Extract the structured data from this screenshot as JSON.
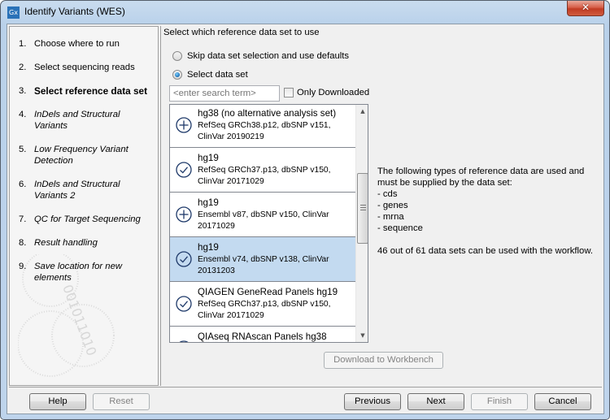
{
  "window": {
    "title": "Identify Variants (WES)",
    "app_icon_text": "Gx",
    "close_symbol": "✕"
  },
  "steps": [
    {
      "num": "1.",
      "label": "Choose where to run",
      "state": "done"
    },
    {
      "num": "2.",
      "label": "Select sequencing reads",
      "state": "done"
    },
    {
      "num": "3.",
      "label": "Select reference data set",
      "state": "current"
    },
    {
      "num": "4.",
      "label": "InDels and Structural Variants",
      "state": "future"
    },
    {
      "num": "5.",
      "label": "Low Frequency Variant Detection",
      "state": "future"
    },
    {
      "num": "6.",
      "label": "InDels and Structural Variants 2",
      "state": "future"
    },
    {
      "num": "7.",
      "label": "QC for Target Sequencing",
      "state": "future"
    },
    {
      "num": "8.",
      "label": "Result handling",
      "state": "future"
    },
    {
      "num": "9.",
      "label": "Save location for new elements",
      "state": "future"
    }
  ],
  "content": {
    "section_title": "Select which reference data set to use",
    "radio_skip": {
      "label": "Skip data set selection and use defaults",
      "checked": false
    },
    "radio_select": {
      "label": "Select data set",
      "checked": true
    },
    "search": {
      "placeholder": "<enter search term>",
      "value": ""
    },
    "only_downloaded": {
      "label": "Only Downloaded",
      "checked": false
    },
    "datasets": [
      {
        "title": "hg38 (no alternative analysis set)",
        "desc": "RefSeq GRCh38.p12, dbSNP v151, ClinVar 20190219",
        "status": "download",
        "icon": "plus-circle-icon",
        "selected": false
      },
      {
        "title": "hg19",
        "desc": "RefSeq GRCh37.p13, dbSNP v150, ClinVar 20171029",
        "status": "downloaded",
        "icon": "check-circle-icon",
        "selected": false
      },
      {
        "title": "hg19",
        "desc": "Ensembl v87, dbSNP v150, ClinVar 20171029",
        "status": "download",
        "icon": "plus-circle-icon",
        "selected": false
      },
      {
        "title": "hg19",
        "desc": "Ensembl v74, dbSNP v138, ClinVar 20131203",
        "status": "downloaded",
        "icon": "check-circle-icon",
        "selected": true
      },
      {
        "title": "QIAGEN GeneRead Panels hg19",
        "desc": "RefSeq GRCh37.p13, dbSNP v150, ClinVar 20171029",
        "status": "downloaded",
        "icon": "check-circle-icon",
        "selected": false
      },
      {
        "title": "QIAseq RNAscan Panels hg38",
        "desc": "",
        "status": "download",
        "icon": "plus-circle-icon",
        "selected": false
      }
    ],
    "scroll_position_fraction": 0.35,
    "info": {
      "intro": "The following types of reference data are used and must be supplied by the data set:",
      "types": [
        "- cds",
        "- genes",
        "- mrna",
        "- sequence"
      ],
      "summary": "46 out of 61 data sets can be used with the workflow."
    },
    "download_button": {
      "label": "Download to Workbench",
      "enabled": false
    }
  },
  "footer": {
    "help": {
      "label": "Help",
      "enabled": true
    },
    "reset": {
      "label": "Reset",
      "enabled": false
    },
    "previous": {
      "label": "Previous",
      "enabled": true
    },
    "next": {
      "label": "Next",
      "enabled": true
    },
    "finish": {
      "label": "Finish",
      "enabled": false
    },
    "cancel": {
      "label": "Cancel",
      "enabled": true
    }
  },
  "colors": {
    "selected_row": "#c3daf0",
    "icon_stroke": "#1f3a6a",
    "close_button": "#c13c24"
  }
}
